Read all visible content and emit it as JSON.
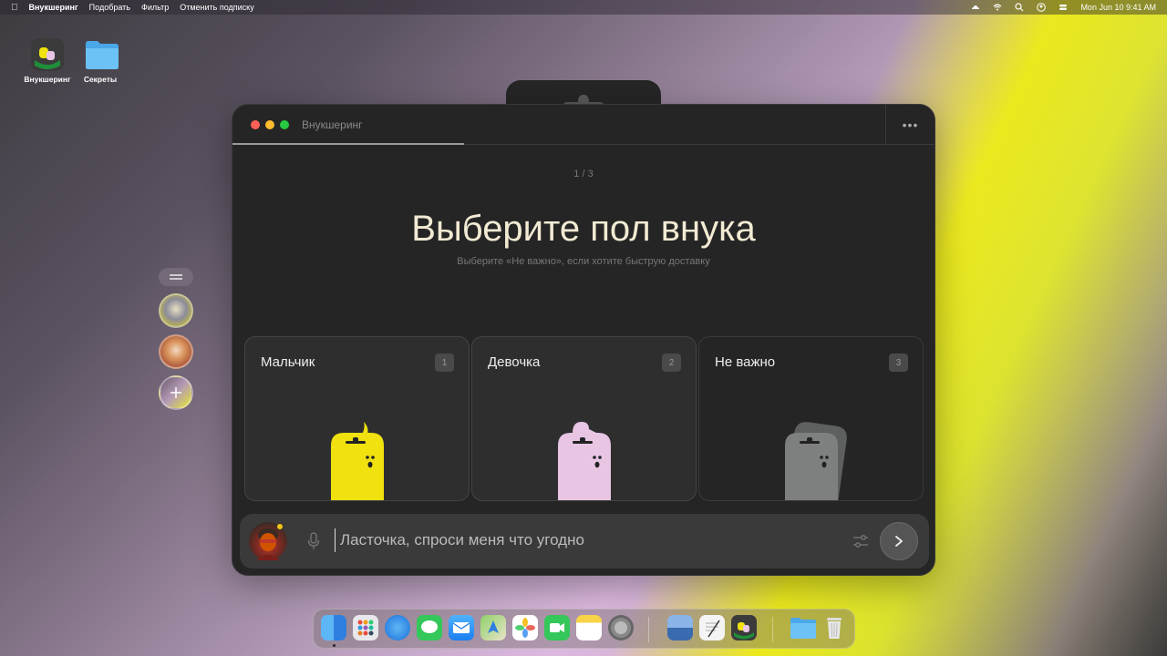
{
  "menubar": {
    "app_name": "Внукшеринг",
    "items": [
      "Подобрать",
      "Фильтр",
      "Отменить подписку"
    ],
    "datetime": "Mon Jun 10  9:41 AM",
    "status_icons": [
      "cloud-icon",
      "wifi-icon",
      "search-icon",
      "user-icon",
      "control-center-icon"
    ]
  },
  "desktop": {
    "icons": [
      {
        "label": "Внукшеринг",
        "icon": "app-icon"
      },
      {
        "label": "Секреты",
        "icon": "folder-icon"
      }
    ]
  },
  "window": {
    "title": "Внукшеринг",
    "more": "•••",
    "step": "1 / 3",
    "heading": "Выберите пол внука",
    "subheading": "Выберите «Не важно», если хотите быструю доставку",
    "progress_fraction": 0.33,
    "options": [
      {
        "label": "Мальчик",
        "shortcut": "1",
        "color": "#f0e10f"
      },
      {
        "label": "Девочка",
        "shortcut": "2",
        "color": "#e7c5e3"
      },
      {
        "label": "Не важно",
        "shortcut": "3",
        "color": "#7e807f"
      }
    ],
    "input": {
      "placeholder": "Ласточка, спроси меня что угодно"
    }
  },
  "colors": {
    "window_bg": "#252525",
    "heading": "#f2ead3",
    "accent_yellow": "#f0e10f",
    "accent_pink": "#e7c5e3"
  },
  "dock": {
    "apps": [
      "finder-icon",
      "launchpad-icon",
      "safari-icon",
      "messages-icon",
      "mail-icon",
      "maps-icon",
      "photos-icon",
      "facetime-icon",
      "notes-icon",
      "settings-icon",
      "preview-icon",
      "textedit-icon",
      "vnuksharing-icon",
      "folder-icon",
      "trash-icon"
    ]
  }
}
